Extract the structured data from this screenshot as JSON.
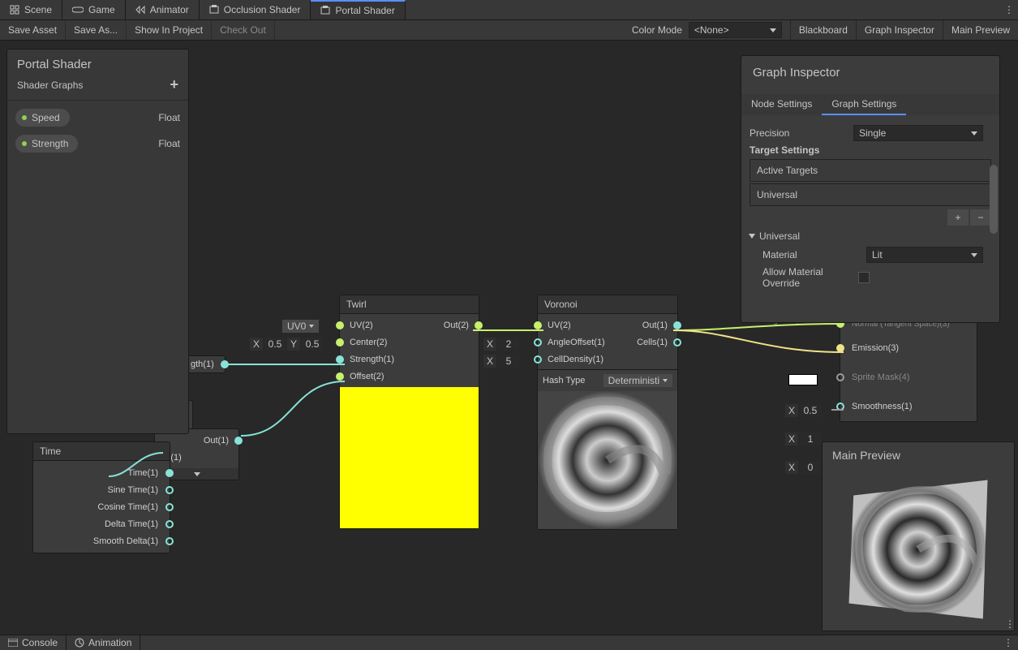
{
  "tabs": [
    {
      "label": "Scene"
    },
    {
      "label": "Game"
    },
    {
      "label": "Animator"
    },
    {
      "label": "Occlusion Shader"
    },
    {
      "label": "Portal Shader"
    }
  ],
  "toolbar": {
    "save_asset": "Save Asset",
    "save_as": "Save As...",
    "show_in_project": "Show In Project",
    "check_out": "Check Out",
    "color_mode": "Color Mode",
    "color_mode_value": "<None>",
    "blackboard": "Blackboard",
    "graph_inspector": "Graph Inspector",
    "main_preview": "Main Preview"
  },
  "blackboard": {
    "title": "Portal Shader",
    "subtitle": "Shader Graphs",
    "props": [
      {
        "name": "Speed",
        "type": "Float"
      },
      {
        "name": "Strength",
        "type": "Float"
      }
    ]
  },
  "inspector": {
    "title": "Graph Inspector",
    "tab_node": "Node Settings",
    "tab_graph": "Graph Settings",
    "precision_lbl": "Precision",
    "precision_val": "Single",
    "target_settings": "Target Settings",
    "active_targets": "Active Targets",
    "target_universal": "Universal",
    "universal_fold": "Universal",
    "material_lbl": "Material",
    "material_val": "Lit",
    "allow_override": "Allow Material Override"
  },
  "nodes": {
    "twirl": {
      "title": "Twirl",
      "uv_sel": "UV0",
      "uv": "UV(2)",
      "center": "Center(2)",
      "strength": "Strength(1)",
      "offset": "Offset(2)",
      "out": "Out(2)",
      "cx_lbl": "X",
      "cx": "0.5",
      "cy_lbl": "Y",
      "cy": "0.5"
    },
    "voronoi": {
      "title": "Voronoi",
      "uv": "UV(2)",
      "angle": "AngleOffset(1)",
      "cell": "CellDensity(1)",
      "out": "Out(1)",
      "cells": "Cells(1)",
      "hash_lbl": "Hash Type",
      "hash_val": "Deterministi",
      "ax_lbl": "X",
      "ax": "2",
      "cd_lbl": "X",
      "cd": "5"
    },
    "time": {
      "title": "Time",
      "t": "Time(1)",
      "s": "Sine Time(1)",
      "c": "Cosine Time(1)",
      "d": "Delta Time(1)",
      "sd": "Smooth Delta(1)"
    },
    "mul": {
      "out": "Out(1)",
      "b": "B(1)"
    },
    "strength": {
      "label": "gth(1)"
    },
    "frag": {
      "tangent": "Tangent Space",
      "normal": "Normal (Tangent Space)(3)",
      "emission": "Emission(3)",
      "sprite": "Sprite Mask(4)",
      "smooth": "Smoothness(1)",
      "smooth_x": "X",
      "smooth_v": "0.5",
      "row5_x": "X",
      "row5_v": "1",
      "row6_x": "X",
      "row6_v": "0"
    }
  },
  "mainprev": {
    "title": "Main Preview"
  },
  "bottom": {
    "console": "Console",
    "animation": "Animation"
  }
}
